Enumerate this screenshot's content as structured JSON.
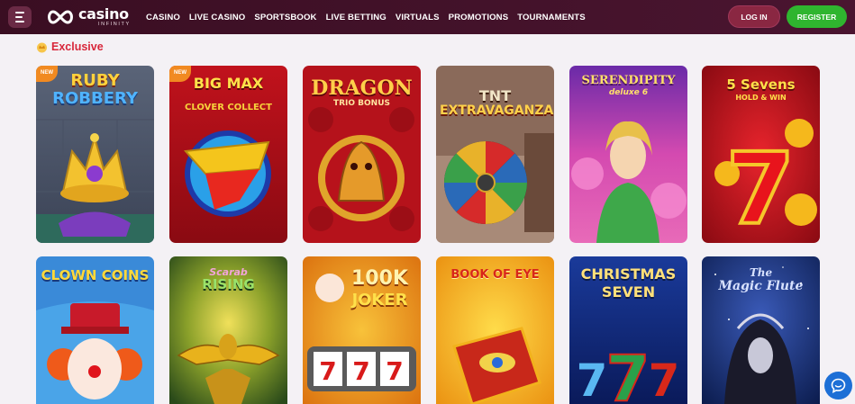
{
  "brand": {
    "name": "casino",
    "tagline": "INFINITY"
  },
  "nav": {
    "items": [
      "CASINO",
      "LIVE CASINO",
      "SPORTSBOOK",
      "LIVE BETTING",
      "VIRTUALS",
      "PROMOTIONS",
      "TOURNAMENTS"
    ]
  },
  "auth": {
    "login_label": "LOG IN",
    "register_label": "REGISTER"
  },
  "section": {
    "title": "Exclusive"
  },
  "badges": {
    "new": "NEW"
  },
  "games": [
    {
      "title": "RUBY",
      "title2": "ROBBERY",
      "new": true
    },
    {
      "title": "BIG MAX",
      "title2": "CLOVER COLLECT",
      "new": true
    },
    {
      "title": "DRAGON",
      "title2": "TRIO BONUS",
      "new": false
    },
    {
      "title": "TNT",
      "title2": "EXTRAVAGANZA",
      "new": false
    },
    {
      "title": "SERENDIPITY",
      "title2": "deluxe 6",
      "new": false
    },
    {
      "title": "5 Sevens",
      "title2": "HOLD & WIN",
      "new": false
    },
    {
      "title": "CLOWN COINS",
      "title2": "",
      "new": false
    },
    {
      "title": "Scarab",
      "title2": "RISING",
      "new": false
    },
    {
      "title": "100K",
      "title2": "JOKER",
      "new": false
    },
    {
      "title": "BOOK OF EYE",
      "title2": "",
      "new": false
    },
    {
      "title": "CHRISTMAS",
      "title2": "SEVEN",
      "new": false
    },
    {
      "title": "The",
      "title2": "Magic Flute",
      "new": false
    }
  ],
  "colors": {
    "accent": "#d8263a",
    "header_bg": "#3a0e22",
    "register_bg": "#2fb52f",
    "login_bg": "#8a2742",
    "chat_bg": "#1d6fd6"
  },
  "icons": {
    "menu": "hamburger-icon",
    "chat": "chat-icon",
    "section": "crown-icon"
  }
}
